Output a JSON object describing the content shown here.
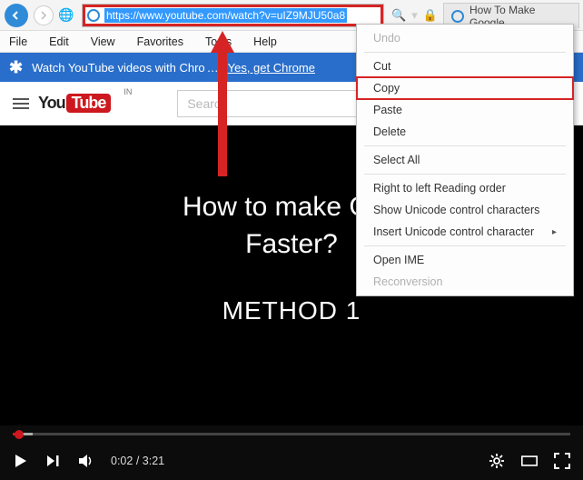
{
  "address_url": "https://www.youtube.com/watch?v=uIZ9MJU50a8",
  "tab_title": "How To Make Google",
  "menu_bar": {
    "file": "File",
    "edit": "Edit",
    "view": "View",
    "favorites": "Favorites",
    "tools": "Tools",
    "help": "Help"
  },
  "promo": {
    "text": "Watch YouTube videos with Chro",
    "link": "Yes, get Chrome"
  },
  "youtube": {
    "logo_you": "You",
    "logo_tube": "Tube",
    "region": "IN",
    "search_placeholder": "Search"
  },
  "video": {
    "title_line": "How to make Google Chrome Faster?",
    "title_visible": "How to make Goo\nFaster?",
    "method_label": "METHOD 1",
    "current_time": "0:02",
    "total_time": "3:21",
    "progress_percent": 1.0,
    "buffer_percent": 4.0
  },
  "context_menu": {
    "undo": "Undo",
    "cut": "Cut",
    "copy": "Copy",
    "paste": "Paste",
    "delete": "Delete",
    "select_all": "Select All",
    "rtl": "Right to left Reading order",
    "show_unicode": "Show Unicode control characters",
    "insert_unicode": "Insert Unicode control character",
    "open_ime": "Open IME",
    "reconversion": "Reconversion"
  },
  "colors": {
    "highlight_red": "#d62424",
    "ie_blue": "#2f8bd8",
    "promo_blue": "#296ecb",
    "yt_red": "#cc181e"
  }
}
